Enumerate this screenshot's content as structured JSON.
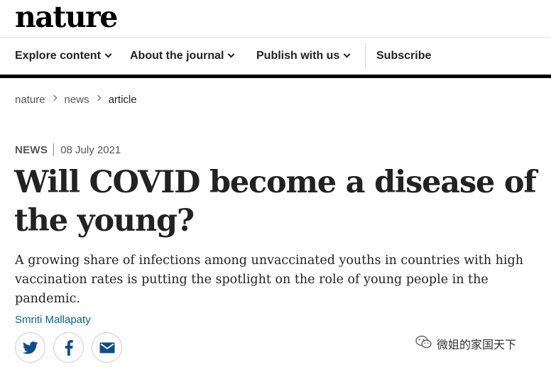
{
  "header": {
    "logo_text": "nature"
  },
  "nav": {
    "items": [
      {
        "label": "Explore content"
      },
      {
        "label": "About the journal"
      },
      {
        "label": "Publish with us"
      }
    ],
    "subscribe_label": "Subscribe"
  },
  "breadcrumb": {
    "items": [
      "nature",
      "news",
      "article"
    ]
  },
  "article": {
    "type": "NEWS",
    "date": "08 July 2021",
    "title": "Will COVID become a disease of the young?",
    "standfirst": "A growing share of infections among unvaccinated youths in countries with high vaccination rates is putting the spotlight on the role of young people in the pandemic.",
    "author": "Smriti Mallapaty"
  },
  "share": {
    "icons": [
      "twitter-icon",
      "facebook-icon",
      "email-icon"
    ]
  },
  "watermark": {
    "text": "微姐的家国天下"
  },
  "colors": {
    "accent_link": "#006699",
    "text": "#222222",
    "nav_rule": "#000000"
  }
}
